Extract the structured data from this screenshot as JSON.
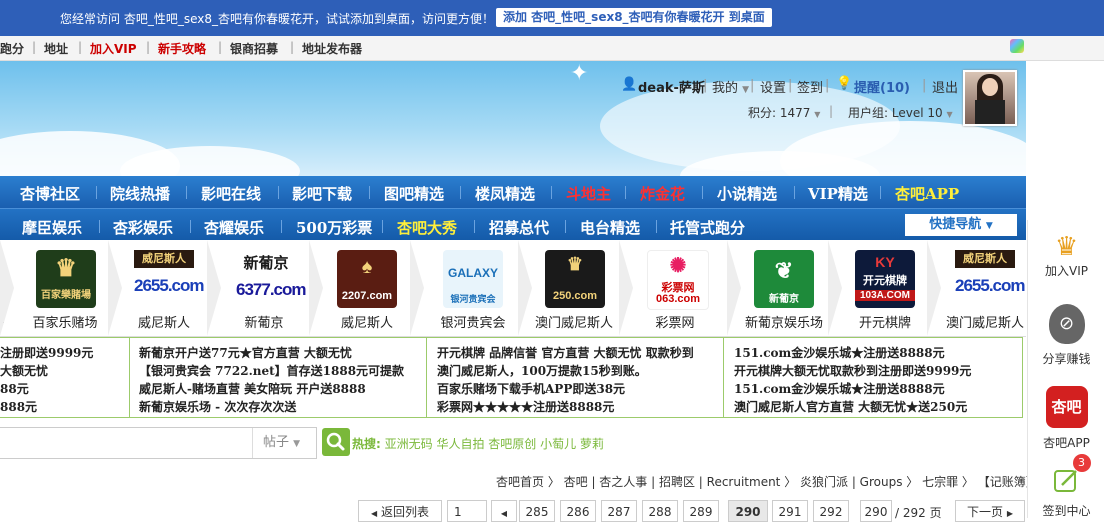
{
  "notice": {
    "text": "您经常访问 杏吧_性吧_sex8_杏吧有你春暖花开，试试添加到桌面，访问更方便！",
    "add_button": "添加 杏吧_性吧_sex8_杏吧有你春暖花开 到桌面"
  },
  "toplinks": [
    "跑分",
    "地址",
    "加入VIP",
    "新手攻略",
    "银商招募",
    "地址发布器"
  ],
  "user": {
    "name": "deak-萨斯",
    "my": "我的",
    "settings": "设置",
    "checkin": "签到",
    "remind": "提醒(10)",
    "logout": "退出",
    "points": "积分: 1477",
    "group": "用户组: Level 10"
  },
  "nav1": [
    "杏博社区",
    "院线热播",
    "影吧在线",
    "影吧下载",
    "图吧精选",
    "楼凤精选",
    "斗地主",
    "炸金花",
    "小说精选",
    "VIP精选",
    "杏吧APP"
  ],
  "nav2": [
    "摩臣娱乐",
    "杏彩娱乐",
    "杏耀娱乐",
    "500万彩票",
    "杏吧大秀",
    "招募总代",
    "电台精选",
    "托管式跑分"
  ],
  "quick_nav": "快捷导航",
  "logos": [
    {
      "name": "百家乐赌场",
      "mark": "百家樂賭場"
    },
    {
      "name": "威尼斯人",
      "mark": "2655.com"
    },
    {
      "name": "新葡京",
      "mark": "6377.com"
    },
    {
      "name": "威尼斯人",
      "mark": "2207.com"
    },
    {
      "name": "银河贵宾会",
      "mark": "GALAXY"
    },
    {
      "name": "澳门威尼斯人",
      "mark": "250.com"
    },
    {
      "name": "彩票网",
      "mark": "063.com"
    },
    {
      "name": "新葡京娱乐场",
      "mark": "新葡京"
    },
    {
      "name": "开元棋牌",
      "mark": "103A.COM"
    },
    {
      "name": "澳门威尼斯人",
      "mark": "2655.com"
    }
  ],
  "logo_left_cut": "m",
  "ads": [
    [
      "注册即送9999元",
      "大额无忧",
      "88元",
      "888元"
    ],
    [
      "新葡京开户送77元★官方直营 大额无忧",
      "【银河贵宾会 7722.net】首存送1888元可提款",
      "威尼斯人-赌场直营 美女陪玩 开户送8888",
      "新葡京娱乐场 - 次次存次次送"
    ],
    [
      "开元棋牌 品牌信誉 官方直营 大额无忧 取款秒到",
      "澳门威尼斯人，100万提款15秒到账。",
      "百家乐赌场下载手机APP即送38元",
      "彩票网★★★★★注册送8888元"
    ],
    [
      "151.com金沙娱乐城★注册送8888元",
      "开元棋牌大额无忧取款秒到注册即送9999元",
      "151.com金沙娱乐城★注册送8888元",
      "澳门威尼斯人官方直营 大额无忧★送250元"
    ]
  ],
  "search": {
    "type": "帖子",
    "hot_label": "热搜:",
    "hot": "亚洲无码 华人自拍 杏吧原创 小萄儿 萝莉"
  },
  "breadcrumb": "杏吧首页 〉 杏吧 | 杏之人事 | 招聘区 | Recruitment 〉 炎狼门派 | Groups 〉 七宗罪 〉 【记账簿】",
  "pager": {
    "back": "返回列表",
    "first": "1",
    "pages": [
      "285",
      "286",
      "287",
      "288",
      "289",
      "290",
      "291",
      "292"
    ],
    "current": "290",
    "input": "290",
    "total": "/ 292 页",
    "next": "下一页"
  },
  "sidebar": [
    "加入VIP",
    "分享赚钱",
    "杏吧APP",
    "签到中心"
  ],
  "sidebar_badge": "3",
  "colors": {
    "nav_blue": "#1a5fb0",
    "accent_red": "#c00000",
    "green": "#7ab83a",
    "yellow": "#ffef3a"
  }
}
